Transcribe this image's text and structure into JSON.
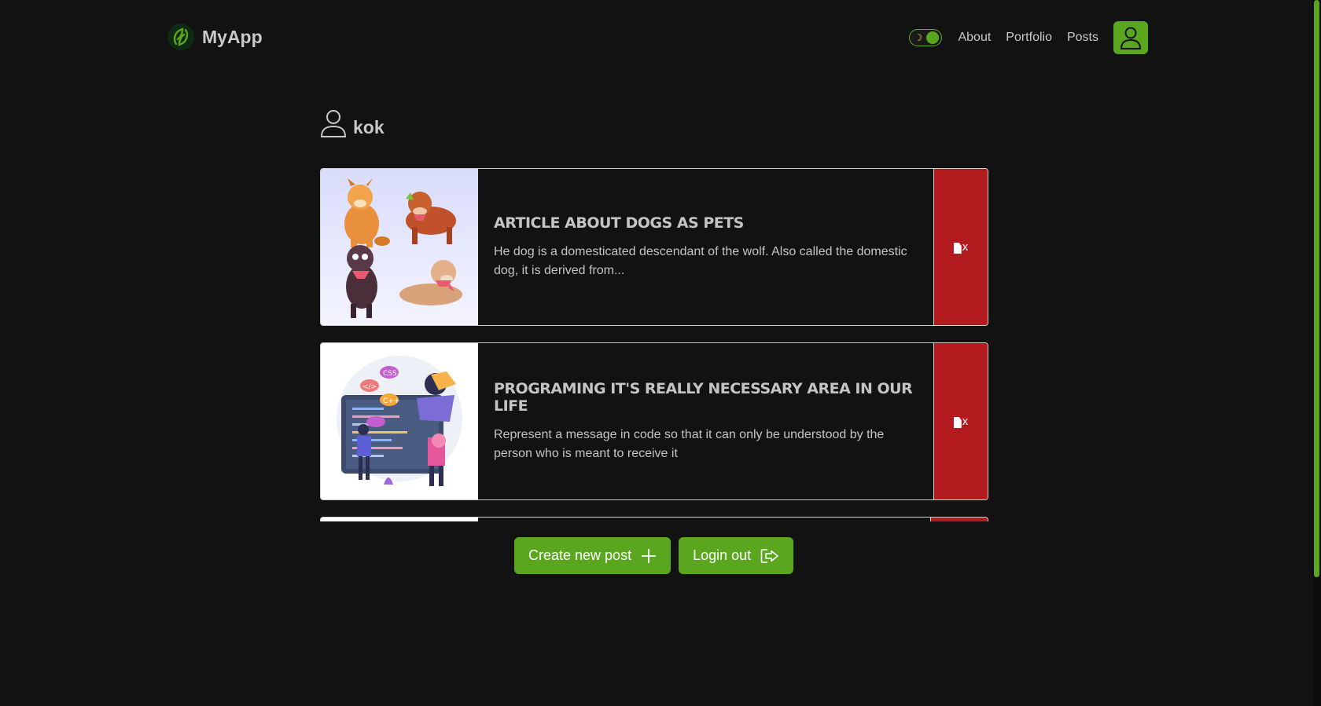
{
  "app": {
    "brand_name": "MyApp",
    "accent_color": "#5aa61e",
    "delete_color": "#b31b1e"
  },
  "nav": {
    "theme_toggle": {
      "state": "dark",
      "icon": "moon-icon"
    },
    "links": [
      {
        "label": "About"
      },
      {
        "label": "Portfolio"
      },
      {
        "label": "Posts"
      }
    ],
    "user_icon": "user-icon"
  },
  "profile": {
    "username": "kok",
    "icon": "user-icon"
  },
  "posts": [
    {
      "title": "Article about dogs as pets",
      "excerpt": "He dog is a domesticated descendant of the wolf. Also called the domestic dog, it is derived from...",
      "thumbnail": "dogs-illustration",
      "delete_label": "x"
    },
    {
      "title": "Programing it's really necessary area in our life",
      "excerpt": "Represent a message in code so that it can only be understood by the person who is meant to receive it",
      "thumbnail": "programming-illustration",
      "delete_label": "x"
    },
    {
      "title": "",
      "excerpt": "",
      "thumbnail": "",
      "delete_label": ""
    }
  ],
  "actions": {
    "create_label": "Create new post",
    "logout_label": "Login out"
  }
}
